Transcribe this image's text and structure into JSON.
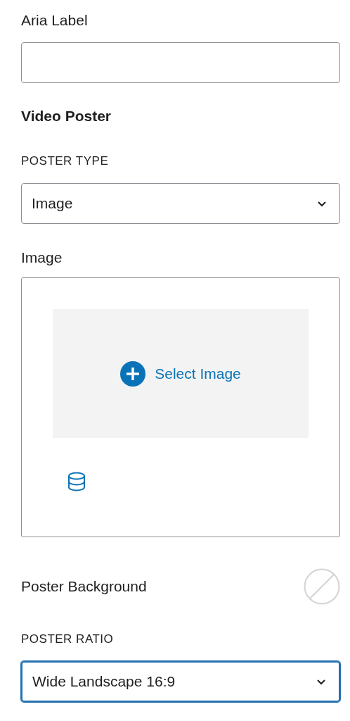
{
  "aria_label": {
    "label": "Aria Label"
  },
  "section_title": "Video Poster",
  "poster_type": {
    "label": "POSTER TYPE",
    "value": "Image",
    "focused": false
  },
  "image": {
    "label": "Image",
    "button": "Select Image"
  },
  "poster_background": {
    "label": "Poster Background",
    "cleared": true
  },
  "poster_ratio": {
    "label": "POSTER RATIO",
    "value": "Wide Landscape 16:9",
    "focused": true
  }
}
